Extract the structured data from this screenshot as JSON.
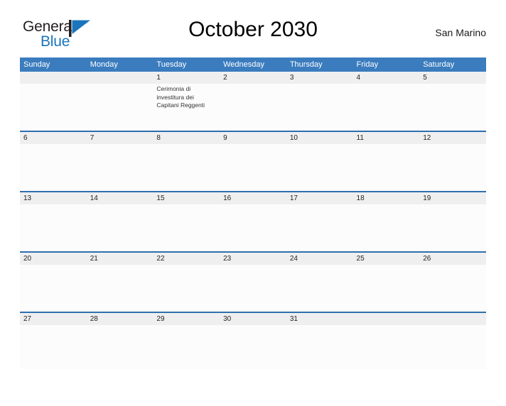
{
  "brand": {
    "name_part1": "General",
    "name_part2": "Blue",
    "flag_icon": "flag-triangle-icon",
    "color_dark": "#231f20",
    "color_blue": "#1b75bb"
  },
  "header": {
    "title": "October 2030",
    "locale": "San Marino"
  },
  "calendar": {
    "accent_header_color": "#3a7cbe",
    "row_band_color": "#efefef",
    "rule_color": "#2f6fae",
    "weekday_headers": [
      "Sunday",
      "Monday",
      "Tuesday",
      "Wednesday",
      "Thursday",
      "Friday",
      "Saturday"
    ],
    "weeks": [
      {
        "days": [
          {
            "num": "",
            "event": ""
          },
          {
            "num": "",
            "event": ""
          },
          {
            "num": "1",
            "event": "Cerimonia di investitura dei Capitani Reggenti"
          },
          {
            "num": "2",
            "event": ""
          },
          {
            "num": "3",
            "event": ""
          },
          {
            "num": "4",
            "event": ""
          },
          {
            "num": "5",
            "event": ""
          }
        ]
      },
      {
        "days": [
          {
            "num": "6",
            "event": ""
          },
          {
            "num": "7",
            "event": ""
          },
          {
            "num": "8",
            "event": ""
          },
          {
            "num": "9",
            "event": ""
          },
          {
            "num": "10",
            "event": ""
          },
          {
            "num": "11",
            "event": ""
          },
          {
            "num": "12",
            "event": ""
          }
        ]
      },
      {
        "days": [
          {
            "num": "13",
            "event": ""
          },
          {
            "num": "14",
            "event": ""
          },
          {
            "num": "15",
            "event": ""
          },
          {
            "num": "16",
            "event": ""
          },
          {
            "num": "17",
            "event": ""
          },
          {
            "num": "18",
            "event": ""
          },
          {
            "num": "19",
            "event": ""
          }
        ]
      },
      {
        "days": [
          {
            "num": "20",
            "event": ""
          },
          {
            "num": "21",
            "event": ""
          },
          {
            "num": "22",
            "event": ""
          },
          {
            "num": "23",
            "event": ""
          },
          {
            "num": "24",
            "event": ""
          },
          {
            "num": "25",
            "event": ""
          },
          {
            "num": "26",
            "event": ""
          }
        ]
      },
      {
        "days": [
          {
            "num": "27",
            "event": ""
          },
          {
            "num": "28",
            "event": ""
          },
          {
            "num": "29",
            "event": ""
          },
          {
            "num": "30",
            "event": ""
          },
          {
            "num": "31",
            "event": ""
          },
          {
            "num": "",
            "event": ""
          },
          {
            "num": "",
            "event": ""
          }
        ]
      }
    ]
  }
}
